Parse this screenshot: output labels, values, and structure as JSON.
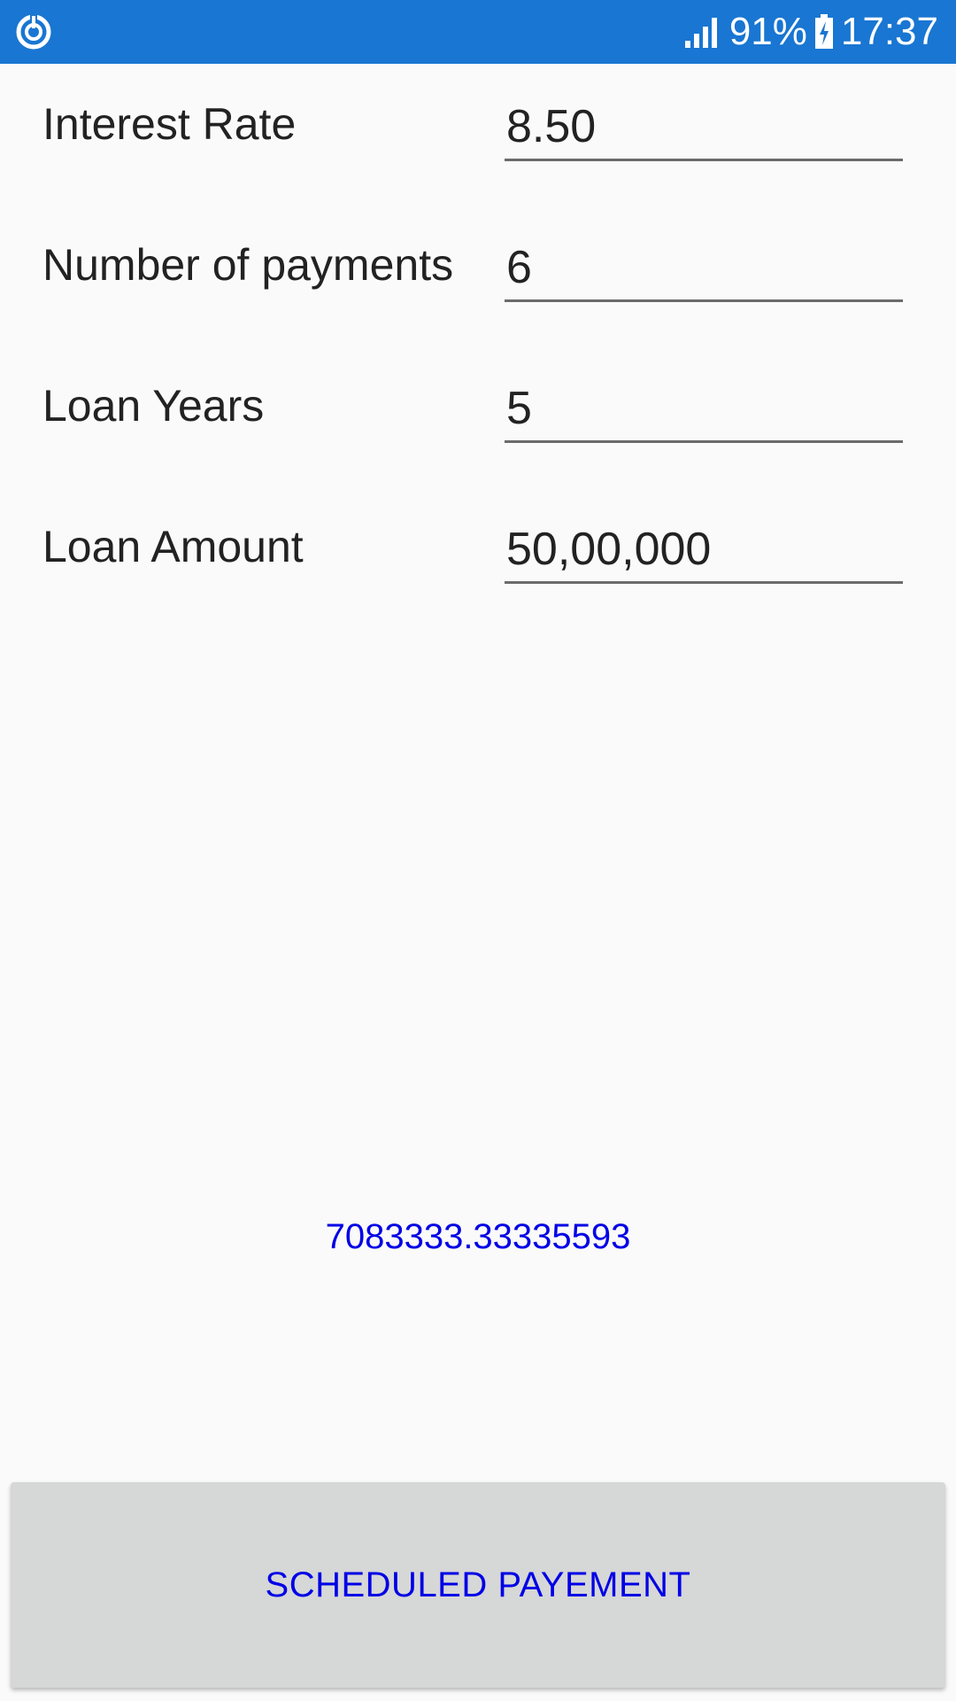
{
  "status_bar": {
    "app_icon": "sync-icon",
    "signal_icon": "signal-icon",
    "battery_percent": "91%",
    "battery_icon": "battery-charging-icon",
    "time": "17:37",
    "background_color": "#1976d2"
  },
  "form": {
    "rows": [
      {
        "label": "Interest Rate",
        "value": "8.50"
      },
      {
        "label": "Number of payments",
        "value": "6"
      },
      {
        "label": "Loan Years",
        "value": "5"
      },
      {
        "label": "Loan Amount",
        "value": "50,00,000"
      }
    ]
  },
  "result": {
    "value": "7083333.33335593",
    "color": "#0000e6"
  },
  "action": {
    "button_label": "SCHEDULED PAYEMENT",
    "button_color": "#d6d7d7"
  }
}
